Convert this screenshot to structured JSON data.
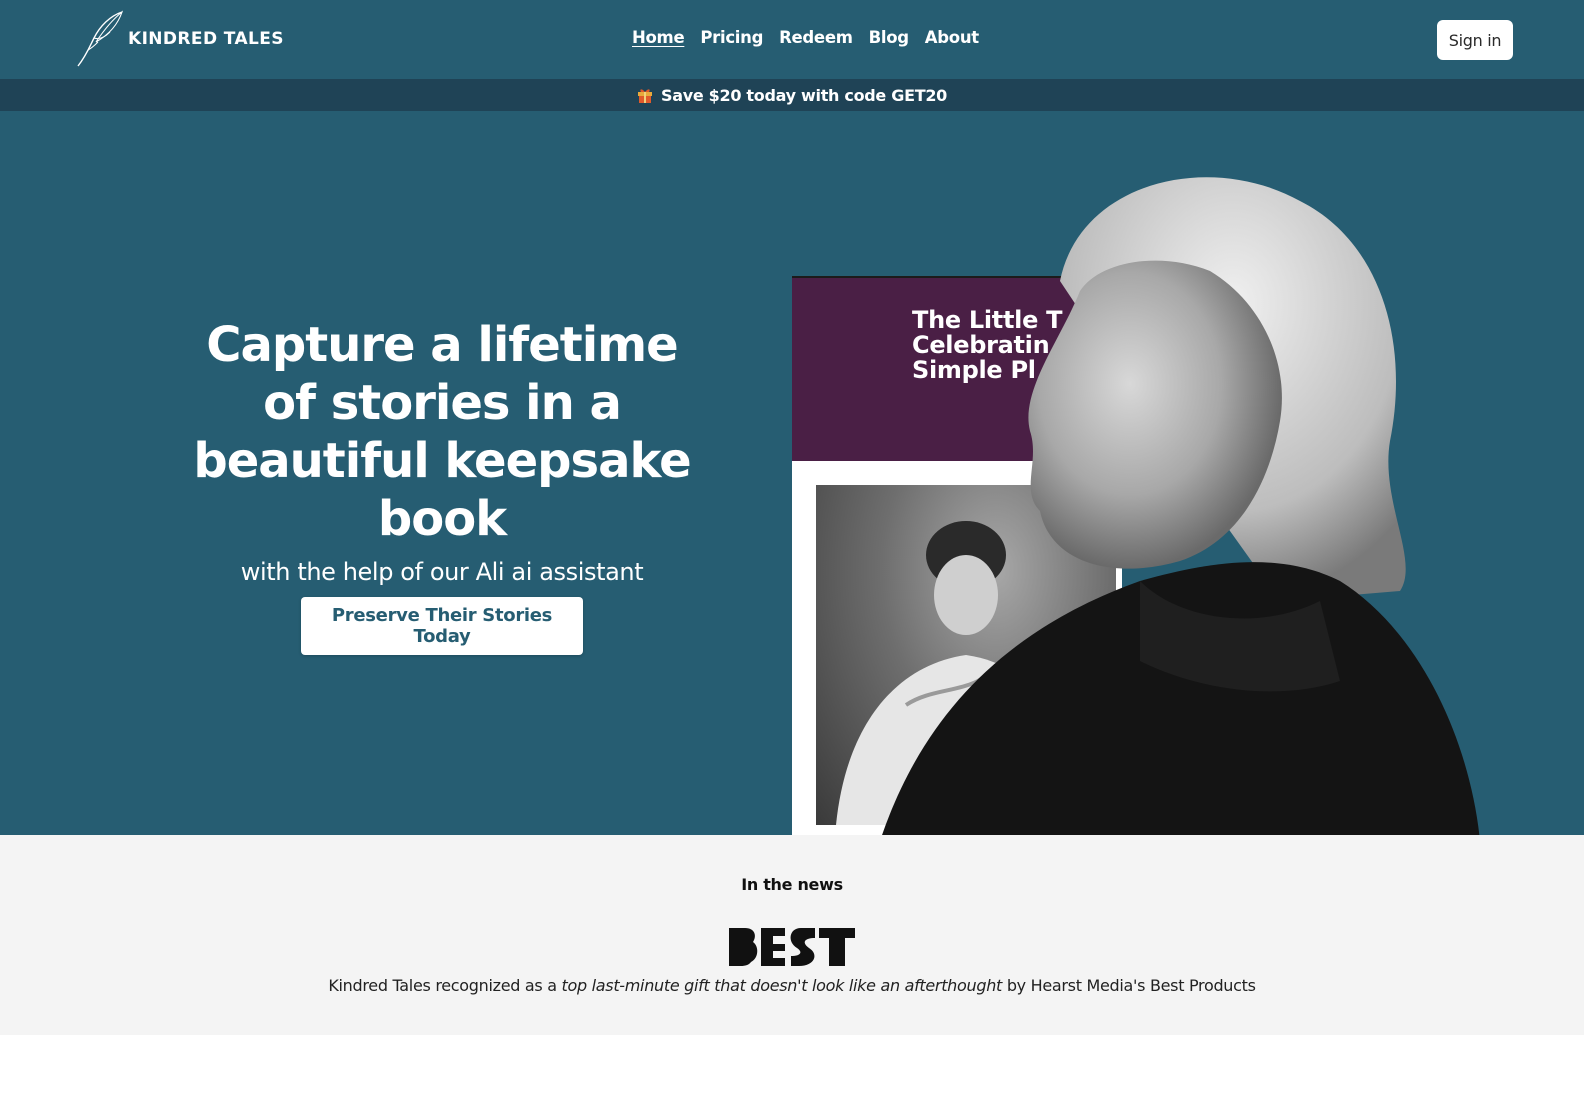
{
  "brand": {
    "name": "KINDRED TALES",
    "logo_icon": "feather-quill-icon"
  },
  "nav": {
    "items": [
      {
        "label": "Home",
        "active": true
      },
      {
        "label": "Pricing",
        "active": false
      },
      {
        "label": "Redeem",
        "active": false
      },
      {
        "label": "Blog",
        "active": false
      },
      {
        "label": "About",
        "active": false
      }
    ],
    "signin_label": "Sign in"
  },
  "promo": {
    "icon": "gift-icon",
    "text": "Save $20 today with code GET20"
  },
  "hero": {
    "title": "Capture a lifetime of stories in a beautiful keepsake book",
    "subtitle": "with the help of our Ali ai assistant",
    "cta_label": "Preserve Their Stories Today",
    "book": {
      "title_visible": "The Little T\nCelebratin\nSimple Pl",
      "cover_color": "#4a1f45"
    }
  },
  "news": {
    "label": "In the news",
    "publication_logo": "BEST",
    "quote_prefix": "Kindred Tales recognized as a ",
    "quote_emphasis": "top last-minute gift that doesn't look like an afterthought",
    "quote_suffix": " by Hearst Media's Best Products"
  },
  "colors": {
    "header_bg": "#265d72",
    "promo_bg": "#1f4356",
    "hero_bg": "#265d72",
    "news_bg": "#f4f4f4",
    "cta_text": "#265d72"
  }
}
